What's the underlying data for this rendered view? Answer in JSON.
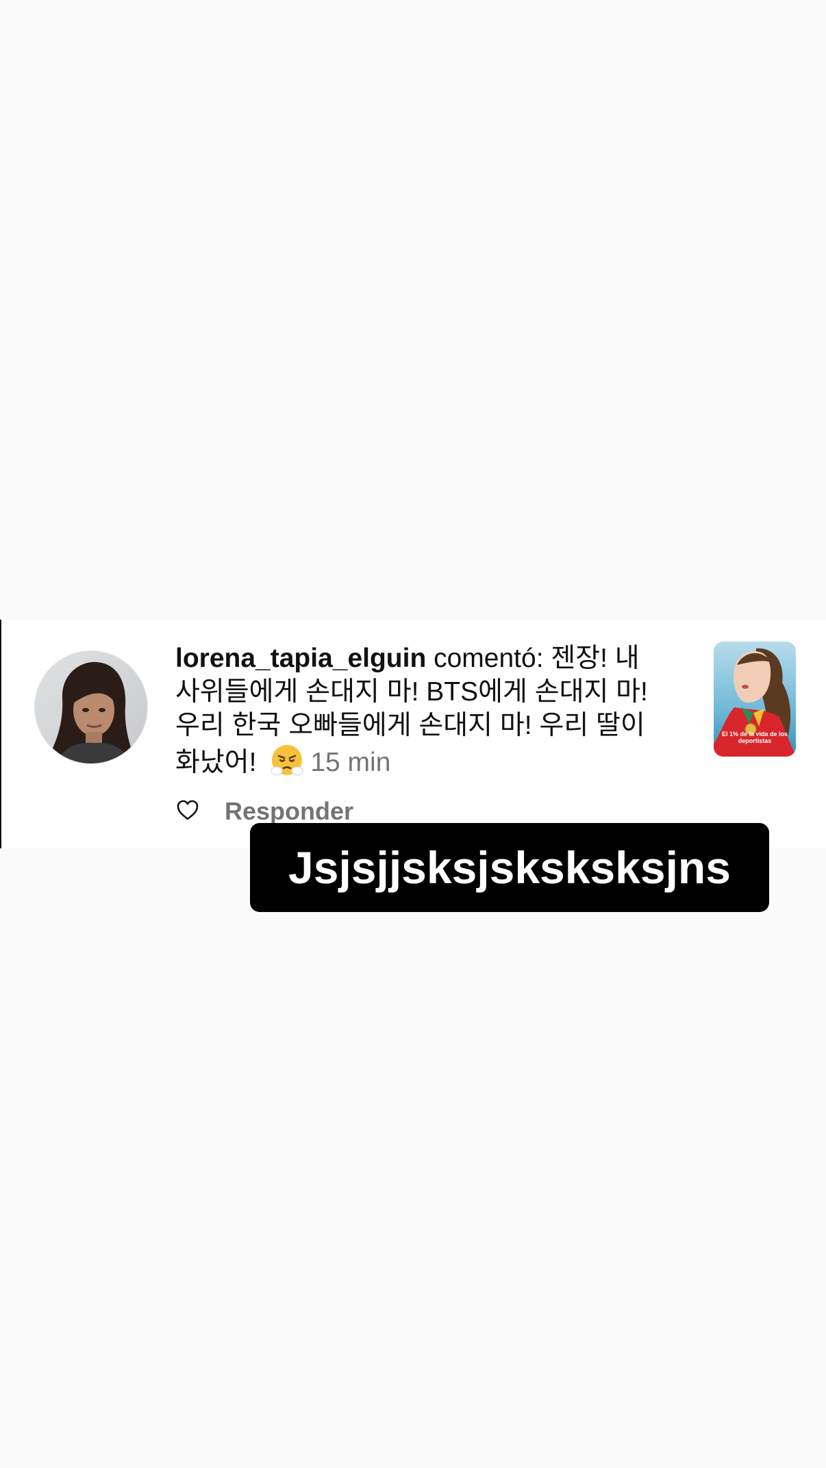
{
  "notification": {
    "username": "lorena_tapia_elguin",
    "action": " comentó: ",
    "comment": "젠장! 내 사위들에게 손대지 마! BTS에게 손대지 마! 우리 한국 오빠들에게 손대지 마! 우리 딸이 화났어!",
    "emoji_icon": "face-with-steam-from-nose-icon",
    "timestamp": "15 min",
    "thumbnail_caption": "El 1% de la vida de los deportistas",
    "like_icon": "heart-outline-icon",
    "reply_label": "Responder"
  },
  "sticker": {
    "text": "Jsjsjjsksjsksksksjns"
  },
  "colors": {
    "background": "#fafafa",
    "card": "#ffffff",
    "text": "#111111",
    "muted": "#737373",
    "sticker_bg": "#000000",
    "sticker_text": "#ffffff"
  }
}
